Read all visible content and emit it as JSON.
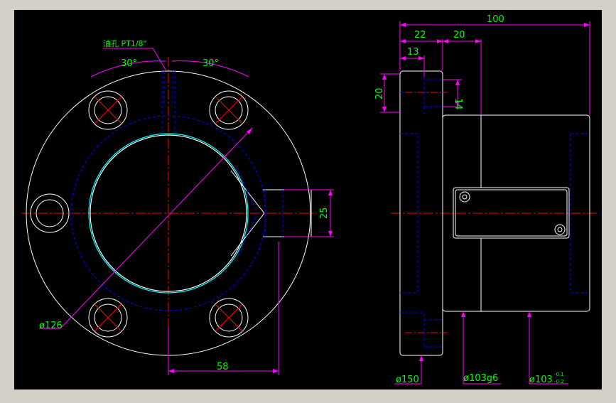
{
  "colors": {
    "frame": "#d4d0c8",
    "background": "#000000",
    "outline": "#ffffff",
    "hidden": "#0000ff",
    "center": "#ff0000",
    "dimension": "#ff00ff",
    "dim_text": "#00ff00",
    "bore": "#00ffff"
  },
  "front_view": {
    "oil_hole_note": "油孔 PT1/8\"",
    "angle_left": "30°",
    "angle_right": "30°",
    "dia_126": "ø126",
    "dim_25": "25",
    "dim_58": "58"
  },
  "side_view": {
    "dim_100": "100",
    "dim_22": "22",
    "dim_20_top": "20",
    "dim_13": "13",
    "dim_20_left": "20",
    "dim_14": "14",
    "dia_150": "ø150",
    "dia_103g6": "ø103g6",
    "dia_103_base": "ø103",
    "tol_upper": "-0.1",
    "tol_lower": "-0.2"
  }
}
